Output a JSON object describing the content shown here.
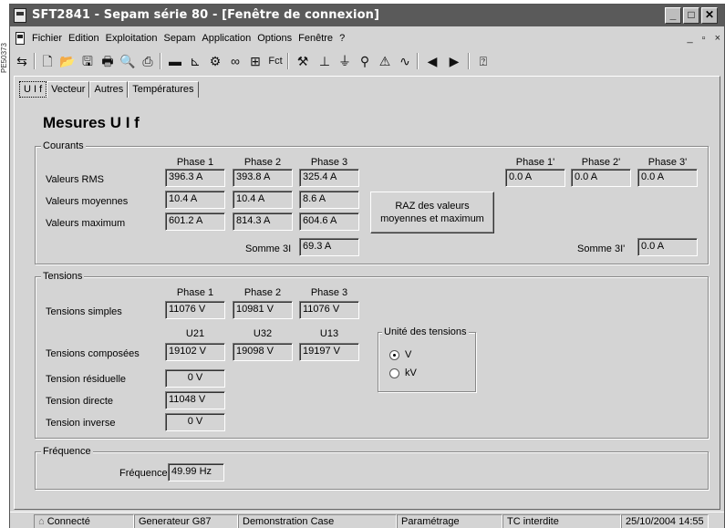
{
  "side_tag": "PE50373",
  "window": {
    "title": "SFT2841 - Sepam série 80 - [Fenêtre de connexion]"
  },
  "menu": {
    "items": [
      "Fichier",
      "Edition",
      "Exploitation",
      "Sepam",
      "Application",
      "Options",
      "Fenêtre",
      "?"
    ],
    "mdi_controls": [
      "_",
      "▫",
      "×"
    ]
  },
  "toolbar": {
    "fct_label": "Fct"
  },
  "tabs": [
    "U I f",
    "Vecteur",
    "Autres",
    "Températures"
  ],
  "page_title": "Mesures U I f",
  "courants": {
    "group_title": "Courants",
    "phase_headers": [
      "Phase 1",
      "Phase 2",
      "Phase 3"
    ],
    "phase_prime_headers": [
      "Phase 1'",
      "Phase 2'",
      "Phase 3'"
    ],
    "rows": [
      {
        "label": "Valeurs RMS",
        "values": [
          "396.3 A",
          "393.8 A",
          "325.4 A"
        ]
      },
      {
        "label": "Valeurs moyennes",
        "values": [
          "10.4 A",
          "10.4 A",
          "8.6 A"
        ]
      },
      {
        "label": "Valeurs maximum",
        "values": [
          "601.2 A",
          "814.3 A",
          "604.6 A"
        ]
      }
    ],
    "prime_rms": [
      "0.0 A",
      "0.0 A",
      "0.0 A"
    ],
    "raz_button": "RAZ des valeurs moyennes et maximum",
    "sum_label": "Somme 3I",
    "sum_value": "69.3 A",
    "sum_prime_label": "Somme 3I'",
    "sum_prime_value": "0.0 A"
  },
  "tensions": {
    "group_title": "Tensions",
    "phase_headers": [
      "Phase 1",
      "Phase 2",
      "Phase 3"
    ],
    "simples_label": "Tensions simples",
    "simples_values": [
      "11076 V",
      "10981 V",
      "11076 V"
    ],
    "composees_headers": [
      "U21",
      "U32",
      "U13"
    ],
    "composees_label": "Tensions composées",
    "composees_values": [
      "19102 V",
      "19098 V",
      "19197 V"
    ],
    "residuelle_label": "Tension résiduelle",
    "residuelle_value": "0 V",
    "directe_label": "Tension directe",
    "directe_value": "11048 V",
    "inverse_label": "Tension inverse",
    "inverse_value": "0 V",
    "unit_group_title": "Unité des tensions",
    "unit_options": [
      "V",
      "kV"
    ],
    "unit_selected": "V"
  },
  "frequence": {
    "group_title": "Fréquence",
    "label": "Fréquence",
    "value": "49.99 Hz"
  },
  "statusbar": {
    "connection": "Connecté",
    "generator": "Generateur G87",
    "case": "Demonstration Case",
    "mode": "Paramétrage",
    "tc": "TC interdite",
    "datetime": "25/10/2004 14:55"
  }
}
